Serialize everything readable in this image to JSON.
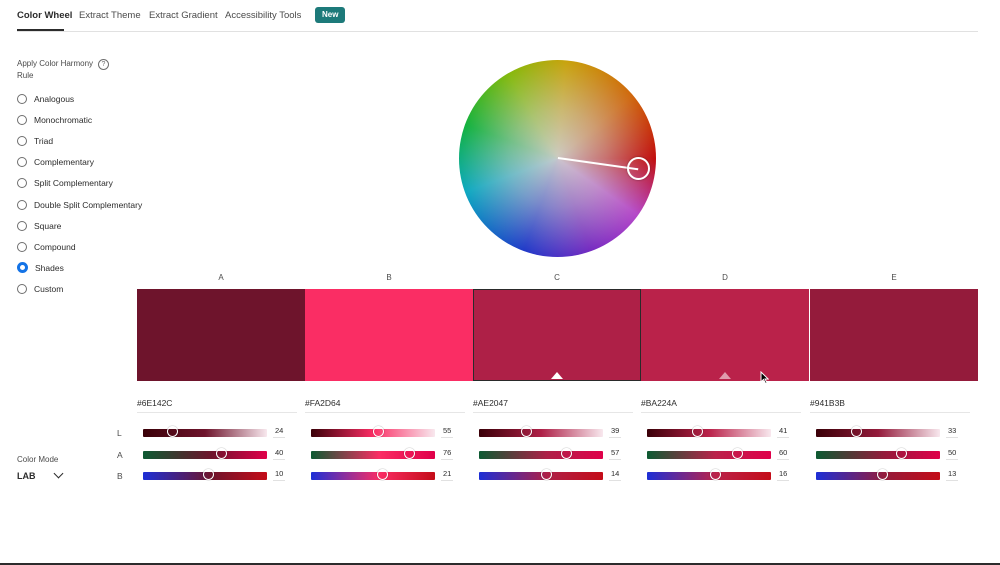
{
  "tabs": {
    "items": [
      "Color Wheel",
      "Extract Theme",
      "Extract Gradient",
      "Accessibility Tools"
    ],
    "badge": "New"
  },
  "harmony": {
    "title": "Apply Color Harmony Rule",
    "help_icon": "question-circle-icon",
    "selected": "Shades",
    "rules": [
      "Analogous",
      "Monochromatic",
      "Triad",
      "Complementary",
      "Split Complementary",
      "Double Split Complementary",
      "Square",
      "Compound",
      "Shades",
      "Custom"
    ]
  },
  "wheel": {
    "colors": [
      "#c00000",
      "#b43ec8",
      "#1530c8",
      "#00a6c0",
      "#06b034",
      "#c8a000"
    ]
  },
  "swatches": [
    {
      "letter": "A",
      "hex": "#6E142C",
      "color": "#6E142C",
      "L": "24",
      "A": "40",
      "B": "10",
      "L_frac": 0.24,
      "A_frac": 0.64,
      "B_frac": 0.53
    },
    {
      "letter": "B",
      "hex": "#FA2D64",
      "color": "#FA2D64",
      "L": "55",
      "A": "76",
      "B": "21",
      "L_frac": 0.55,
      "A_frac": 0.8,
      "B_frac": 0.58
    },
    {
      "letter": "C",
      "hex": "#AE2047",
      "color": "#AE2047",
      "L": "39",
      "A": "57",
      "B": "14",
      "L_frac": 0.39,
      "A_frac": 0.71,
      "B_frac": 0.55
    },
    {
      "letter": "D",
      "hex": "#BA224A",
      "color": "#BA224A",
      "L": "41",
      "A": "60",
      "B": "16",
      "L_frac": 0.41,
      "A_frac": 0.73,
      "B_frac": 0.56
    },
    {
      "letter": "E",
      "hex": "#941B3B",
      "color": "#941B3B",
      "L": "33",
      "A": "50",
      "B": "13",
      "L_frac": 0.33,
      "A_frac": 0.69,
      "B_frac": 0.54
    }
  ],
  "selected_swatch": "C",
  "axis_labels": {
    "L": "L",
    "A": "A",
    "B": "B"
  },
  "color_mode": {
    "label": "Color Mode",
    "value": "LAB"
  }
}
